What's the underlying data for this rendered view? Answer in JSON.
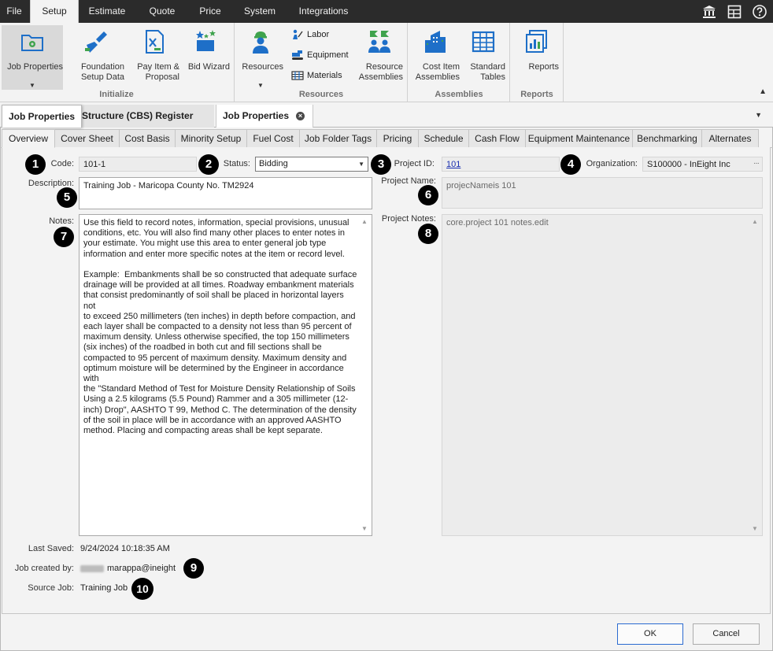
{
  "menubar": {
    "items": [
      "File",
      "Setup",
      "Estimate",
      "Quote",
      "Price",
      "System",
      "Integrations"
    ],
    "active": "Setup",
    "right_icons": [
      "bank-icon",
      "grid-icon",
      "help-icon"
    ]
  },
  "ribbon": {
    "initialize": {
      "label": "Initialize",
      "job_properties": "Job Properties",
      "foundation_setup_data": "Foundation\nSetup Data",
      "pay_item_proposal": "Pay Item &\nProposal",
      "bid_wizard": "Bid Wizard"
    },
    "resources": {
      "label": "Resources",
      "resources": "Resources",
      "labor": "Labor",
      "equipment": "Equipment",
      "materials": "Materials",
      "resource_assemblies": "Resource\nAssemblies"
    },
    "assemblies": {
      "label": "Assemblies",
      "cost_item_assemblies": "Cost Item\nAssemblies",
      "standard_tables": "Standard\nTables"
    },
    "reports": {
      "label": "Reports",
      "reports": "Reports"
    }
  },
  "doc_tabs": {
    "first": "Job Properties",
    "second": "Structure (CBS) Register",
    "third": "Job Properties"
  },
  "sub_tabs": [
    "Overview",
    "Cover Sheet",
    "Cost Basis",
    "Minority Setup",
    "Fuel Cost",
    "Job Folder Tags",
    "Pricing",
    "Schedule",
    "Cash Flow",
    "Equipment Maintenance",
    "Benchmarking",
    "Alternates"
  ],
  "form": {
    "code_label": "Code:",
    "code_value": "101-1",
    "status_label": "Status:",
    "status_value": "Bidding",
    "project_id_label": "Project ID:",
    "project_id_value": "101",
    "organization_label": "Organization:",
    "organization_value": "S100000 - InEight Inc",
    "description_label": "Description:",
    "description_value": "Training Job - Maricopa County No. TM2924",
    "project_name_label": "Project Name:",
    "project_name_value": "projecNameis 101",
    "notes_label": "Notes:",
    "notes_value": "Use this field to record notes, information, special provisions, unusual\nconditions, etc. You will also find many other places to enter notes in\nyour estimate. You might use this area to enter general job type\ninformation and enter more specific notes at the item or record level.\n\nExample:  Embankments shall be so constructed that adequate surface\ndrainage will be provided at all times. Roadway embankment materials\nthat consist predominantly of soil shall be placed in horizontal layers not\nto exceed 250 millimeters (ten inches) in depth before compaction, and\neach layer shall be compacted to a density not less than 95 percent of\nmaximum density. Unless otherwise specified, the top 150 millimeters\n(six inches) of the roadbed in both cut and fill sections shall be\ncompacted to 95 percent of maximum density. Maximum density and\noptimum moisture will be determined by the Engineer in accordance with\nthe \"Standard Method of Test for Moisture Density Relationship of Soils\nUsing a 2.5 kilograms (5.5 Pound) Rammer and a 305 millimeter (12-\ninch) Drop\", AASHTO T 99, Method C. The determination of the density\nof the soil in place will be in accordance with an approved AASHTO\nmethod. Placing and compacting areas shall be kept separate.",
    "project_notes_label": "Project Notes:",
    "project_notes_value": "core.project 101 notes.edit",
    "last_saved_label": "Last Saved:",
    "last_saved_value": "9/24/2024 10:18:35 AM",
    "job_created_by_label": "Job created by:",
    "job_created_by_value": "marappa@ineight",
    "source_job_label": "Source Job:",
    "source_job_value": "Training Job"
  },
  "callouts": [
    "1",
    "2",
    "3",
    "4",
    "5",
    "6",
    "7",
    "8",
    "9",
    "10"
  ],
  "buttons": {
    "ok": "OK",
    "cancel": "Cancel"
  },
  "colors": {
    "menubar_bg": "#2b2b2b",
    "ribbon_bg": "#f3f3f3",
    "accent_blue": "#1e6fc8",
    "accent_green": "#3fa34d",
    "link": "#1a2fb0"
  }
}
